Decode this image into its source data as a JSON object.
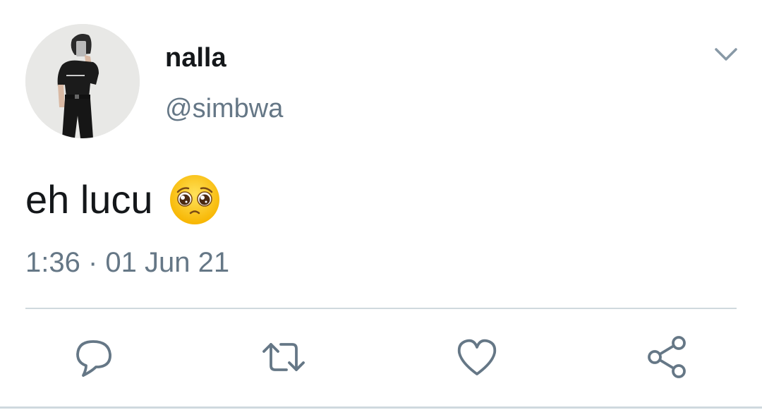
{
  "tweet": {
    "author": {
      "display_name": "nalla",
      "handle": "@simbwa",
      "avatar": "profile-photo"
    },
    "text": "eh lucu",
    "emoji": "pleading-face-emoji",
    "timestamp": "1:36 · 01 Jun 21"
  },
  "actions": {
    "reply": "reply-icon",
    "retweet": "retweet-icon",
    "like": "heart-icon",
    "share": "share-icon"
  },
  "colors": {
    "text_primary": "#14171a",
    "text_secondary": "#657786",
    "icon": "#657786",
    "divider": "#cfd9de"
  }
}
